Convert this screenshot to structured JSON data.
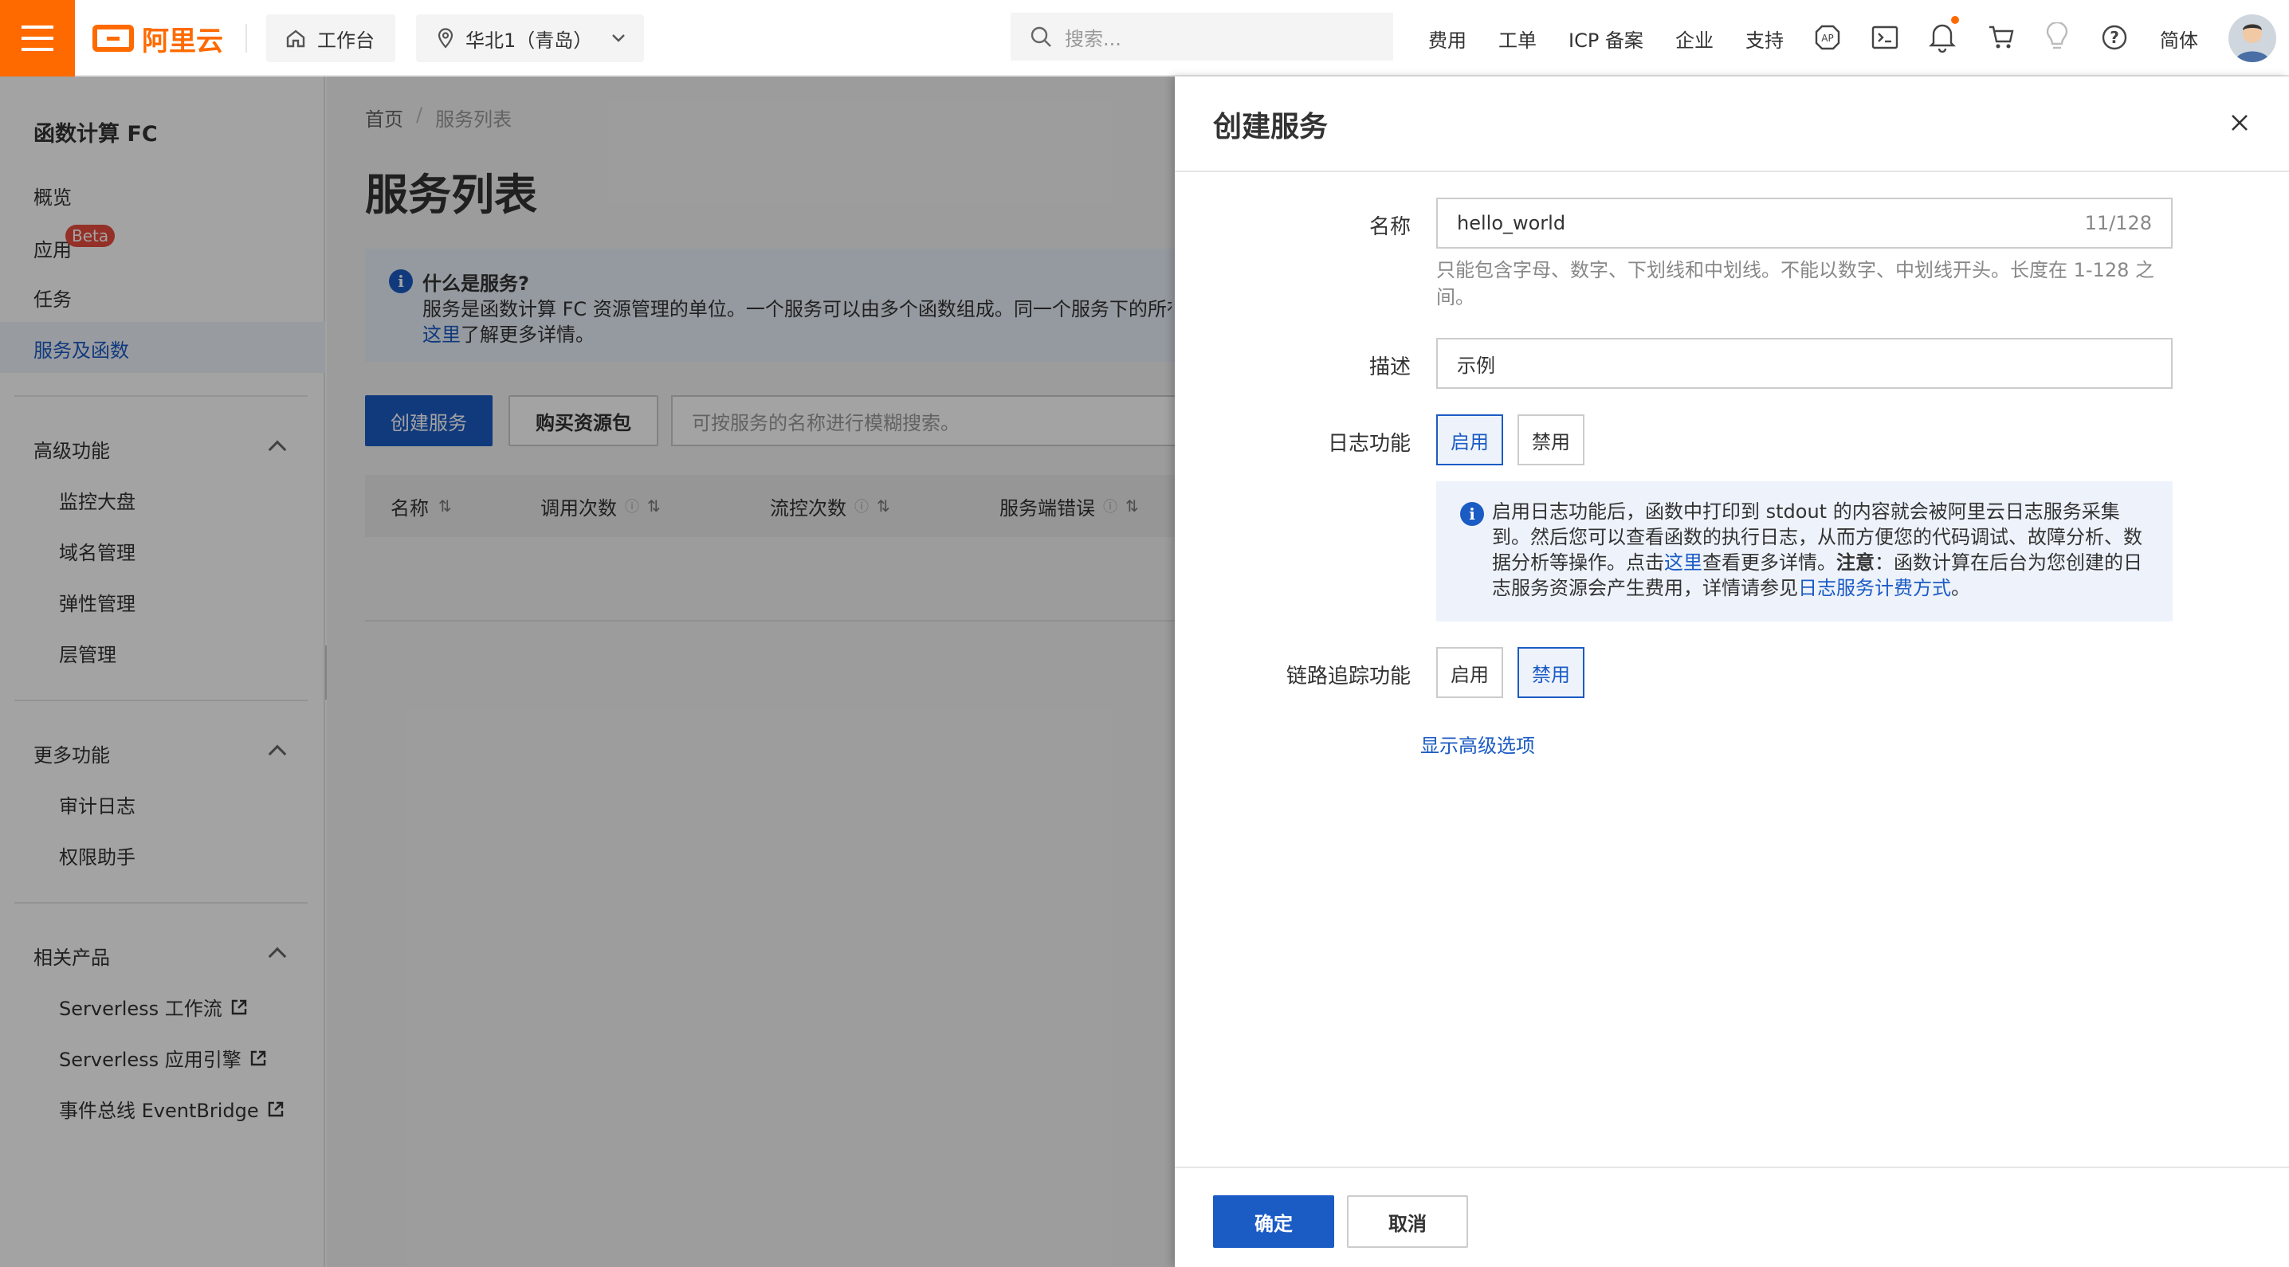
{
  "topbar": {
    "logo_text": "阿里云",
    "workbench": "工作台",
    "region": "华北1（青岛）",
    "search_placeholder": "搜索...",
    "nav": [
      "费用",
      "工单",
      "ICP 备案",
      "企业",
      "支持"
    ],
    "lang": "简体",
    "accent_color": "#ff6a00"
  },
  "sidebar": {
    "title": "函数计算 FC",
    "items": [
      "概览",
      "应用",
      "任务",
      "服务及函数"
    ],
    "beta_badge": "Beta",
    "group_advanced": "高级功能",
    "advanced_items": [
      "监控大盘",
      "域名管理",
      "弹性管理",
      "层管理"
    ],
    "group_more": "更多功能",
    "more_items": [
      "审计日志",
      "权限助手"
    ],
    "group_related": "相关产品",
    "related_items": [
      "Serverless 工作流",
      "Serverless 应用引擎",
      "事件总线 EventBridge"
    ]
  },
  "main": {
    "breadcrumb_home": "首页",
    "breadcrumb_sep": "/",
    "breadcrumb_current": "服务列表",
    "page_title": "服务列表",
    "info_title": "什么是服务?",
    "info_text": "服务是函数计算 FC 资源管理的单位。一个服务可以由多个函数组成。同一个服务下的所有",
    "info_link": "这里",
    "info_tail": "了解更多详情。",
    "create_button": "创建服务",
    "buy_button": "购买资源包",
    "search_placeholder": "可按服务的名称进行模糊搜索。",
    "columns": [
      "名称",
      "调用次数",
      "流控次数",
      "服务端错误"
    ]
  },
  "drawer": {
    "title": "创建服务",
    "name_label": "名称",
    "name_value": "hello_world",
    "name_count": "11/128",
    "name_help": "只能包含字母、数字、下划线和中划线。不能以数字、中划线开头。长度在 1-128 之间。",
    "desc_label": "描述",
    "desc_value": "示例",
    "log_label": "日志功能",
    "enable": "启用",
    "disable": "禁用",
    "log_notice_1": "启用日志功能后，函数中打印到 stdout 的内容就会被阿里云日志服务采集到。然后您可以查看函数的执行日志，从而方便您的代码调试、故障分析、数据分析等操作。点击",
    "log_notice_link1": "这里",
    "log_notice_2": "查看更多详情。",
    "log_notice_bold": "注意",
    "log_notice_3": "：函数计算在后台为您创建的日志服务资源会产生费用，详情请参见",
    "log_notice_link2": "日志服务计费方式",
    "log_notice_4": "。",
    "trace_label": "链路追踪功能",
    "advanced_link": "显示高级选项",
    "ok_button": "确定",
    "cancel_button": "取消",
    "primary_color": "#1b5bc4"
  }
}
